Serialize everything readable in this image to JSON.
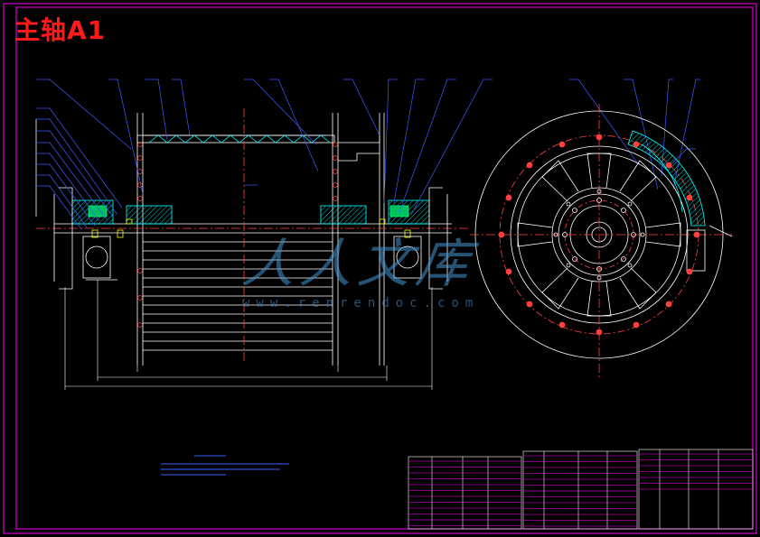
{
  "title": "主轴A1",
  "watermark": {
    "text": "人人文库",
    "url": "www.renrendoc.com"
  },
  "colors": {
    "background": "#000000",
    "frame": "#ff00ff",
    "title": "#ff1a1a",
    "outline": "#ffffff",
    "leader": "#3c5cff",
    "parts": "#00ffff",
    "hidden": "#ff4040",
    "green": "#00ff66",
    "yellow": "#ffff00",
    "watermark": "#4696d2"
  }
}
